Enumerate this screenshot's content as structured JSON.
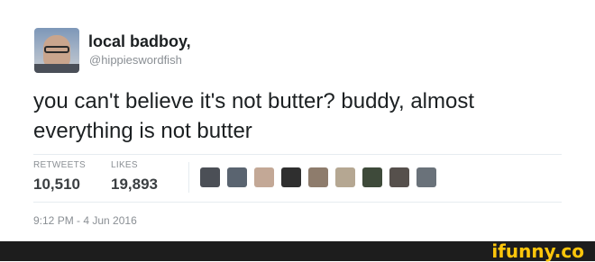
{
  "tweet": {
    "display_name": "local badboy,",
    "handle": "@hippieswordfish",
    "text": "you can't believe it's not butter? buddy, almost everything is not butter",
    "retweets_label": "RETWEETS",
    "retweets_count": "10,510",
    "likes_label": "LIKES",
    "likes_count": "19,893",
    "timestamp": "9:12 PM - 4 Jun 2016"
  },
  "likers": [
    {
      "color": "#4b4f56"
    },
    {
      "color": "#5a6470"
    },
    {
      "color": "#c3a896"
    },
    {
      "color": "#2f2f2f"
    },
    {
      "color": "#8e7c6c"
    },
    {
      "color": "#b5a792"
    },
    {
      "color": "#3e4a3a"
    },
    {
      "color": "#56504c"
    },
    {
      "color": "#6a727a"
    }
  ],
  "watermark": {
    "text": "ifunny.co",
    "color": "#ffc60b"
  }
}
